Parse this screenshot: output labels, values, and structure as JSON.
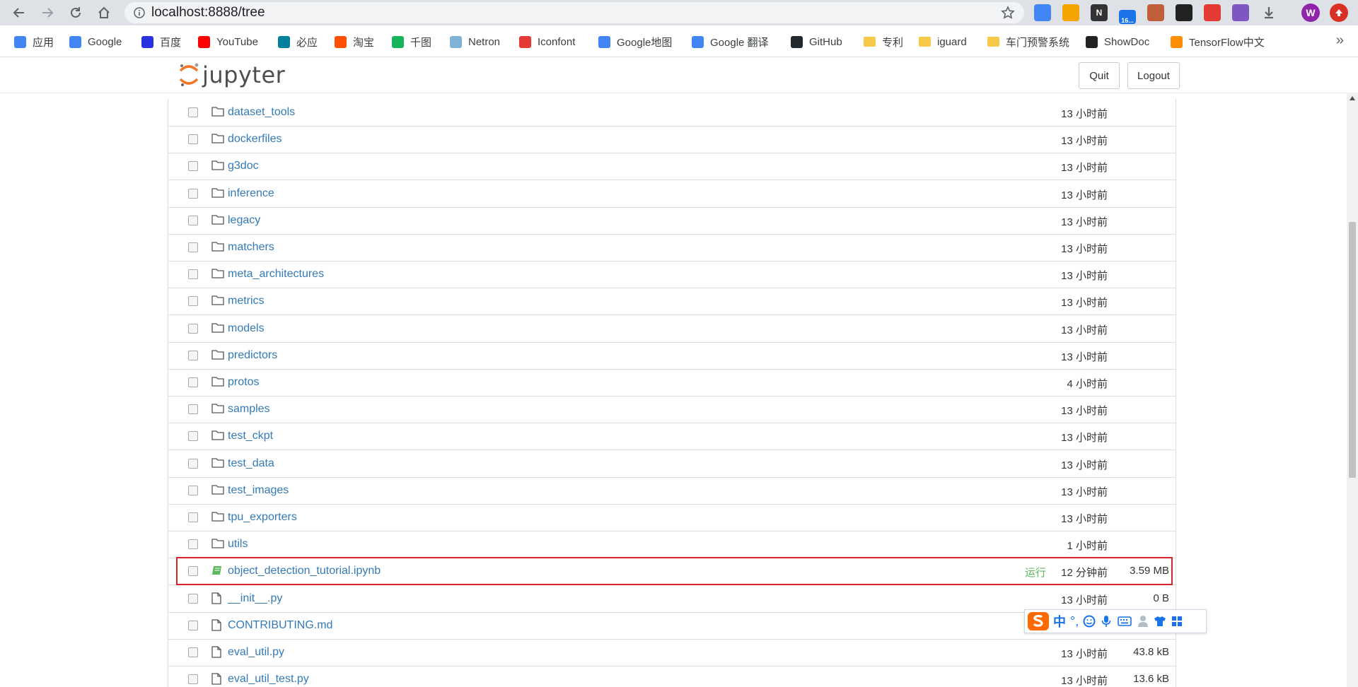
{
  "browser": {
    "url": "localhost:8888/tree",
    "extensions": [
      {
        "icon": "translate-icon",
        "color": "#4285f4",
        "label": ""
      },
      {
        "icon": "infinity-icon",
        "color": "#f4a300",
        "label": ""
      },
      {
        "icon": "notion-icon",
        "color": "#333333",
        "label": "N"
      },
      {
        "icon": "badge-icon",
        "color": "#1a73e8",
        "label": "16..."
      },
      {
        "icon": "monkey-icon",
        "color": "#c0603a",
        "label": ""
      },
      {
        "icon": "glasses-icon",
        "color": "#222222",
        "label": ""
      },
      {
        "icon": "refresh-red-icon",
        "color": "#e53935",
        "label": ""
      },
      {
        "icon": "purple-star-icon",
        "color": "#7e57c2",
        "label": ""
      },
      {
        "icon": "download-icon",
        "color": "#5f6368",
        "label": ""
      }
    ],
    "profile_letter": "W",
    "bookmarks": [
      {
        "label": "应用",
        "icon": "apps-grid-icon",
        "color": "#4285f4"
      },
      {
        "label": "Google",
        "icon": "google-icon",
        "color": "#4285f4"
      },
      {
        "label": "百度",
        "icon": "baidu-icon",
        "color": "#2932e1"
      },
      {
        "label": "YouTube",
        "icon": "youtube-icon",
        "color": "#ff0000"
      },
      {
        "label": "必应",
        "icon": "bing-icon",
        "color": "#00809d"
      },
      {
        "label": "淘宝",
        "icon": "taobao-icon",
        "color": "#ff5000"
      },
      {
        "label": "千图",
        "icon": "qiantu-icon",
        "color": "#16b35a"
      },
      {
        "label": "Netron",
        "icon": "netron-icon",
        "color": "#7fb3d5"
      },
      {
        "label": "Iconfont",
        "icon": "iconfont-icon",
        "color": "#e53935"
      },
      {
        "label": "Google地图",
        "icon": "google-maps-icon",
        "color": "#4285f4"
      },
      {
        "label": "Google 翻译",
        "icon": "google-translate-icon",
        "color": "#4285f4"
      },
      {
        "label": "GitHub",
        "icon": "github-icon",
        "color": "#24292e"
      },
      {
        "label": "专利",
        "icon": "folder-icon",
        "color": "#f7c948"
      },
      {
        "label": "iguard",
        "icon": "folder-icon",
        "color": "#f7c948"
      },
      {
        "label": "车门预警系统",
        "icon": "folder-icon",
        "color": "#f7c948"
      },
      {
        "label": "ShowDoc",
        "icon": "showdoc-icon",
        "color": "#222222"
      },
      {
        "label": "TensorFlow中文",
        "icon": "tensorflow-icon",
        "color": "#ff8f00"
      }
    ],
    "more_bookmarks": "»"
  },
  "jupyter": {
    "logo_text": "jupyter",
    "quit_label": "Quit",
    "logout_label": "Logout"
  },
  "files": [
    {
      "name": "dataset_tools",
      "type": "folder",
      "time": "13 小时前",
      "size": "",
      "running": ""
    },
    {
      "name": "dockerfiles",
      "type": "folder",
      "time": "13 小时前",
      "size": "",
      "running": ""
    },
    {
      "name": "g3doc",
      "type": "folder",
      "time": "13 小时前",
      "size": "",
      "running": ""
    },
    {
      "name": "inference",
      "type": "folder",
      "time": "13 小时前",
      "size": "",
      "running": ""
    },
    {
      "name": "legacy",
      "type": "folder",
      "time": "13 小时前",
      "size": "",
      "running": ""
    },
    {
      "name": "matchers",
      "type": "folder",
      "time": "13 小时前",
      "size": "",
      "running": ""
    },
    {
      "name": "meta_architectures",
      "type": "folder",
      "time": "13 小时前",
      "size": "",
      "running": ""
    },
    {
      "name": "metrics",
      "type": "folder",
      "time": "13 小时前",
      "size": "",
      "running": ""
    },
    {
      "name": "models",
      "type": "folder",
      "time": "13 小时前",
      "size": "",
      "running": ""
    },
    {
      "name": "predictors",
      "type": "folder",
      "time": "13 小时前",
      "size": "",
      "running": ""
    },
    {
      "name": "protos",
      "type": "folder",
      "time": "4 小时前",
      "size": "",
      "running": ""
    },
    {
      "name": "samples",
      "type": "folder",
      "time": "13 小时前",
      "size": "",
      "running": ""
    },
    {
      "name": "test_ckpt",
      "type": "folder",
      "time": "13 小时前",
      "size": "",
      "running": ""
    },
    {
      "name": "test_data",
      "type": "folder",
      "time": "13 小时前",
      "size": "",
      "running": ""
    },
    {
      "name": "test_images",
      "type": "folder",
      "time": "13 小时前",
      "size": "",
      "running": ""
    },
    {
      "name": "tpu_exporters",
      "type": "folder",
      "time": "13 小时前",
      "size": "",
      "running": ""
    },
    {
      "name": "utils",
      "type": "folder",
      "time": "1 小时前",
      "size": "",
      "running": ""
    },
    {
      "name": "object_detection_tutorial.ipynb",
      "type": "notebook",
      "time": "12 分钟前",
      "size": "3.59 MB",
      "running": "运行"
    },
    {
      "name": "__init__.py",
      "type": "file",
      "time": "13 小时前",
      "size": "0 B",
      "running": ""
    },
    {
      "name": "CONTRIBUTING.md",
      "type": "file",
      "time": "",
      "size": "",
      "running": ""
    },
    {
      "name": "eval_util.py",
      "type": "file",
      "time": "13 小时前",
      "size": "43.8 kB",
      "running": ""
    },
    {
      "name": "eval_util_test.py",
      "type": "file",
      "time": "13 小时前",
      "size": "13.6 kB",
      "running": ""
    }
  ],
  "ime": {
    "mode": "中",
    "punctuation": "°,"
  }
}
